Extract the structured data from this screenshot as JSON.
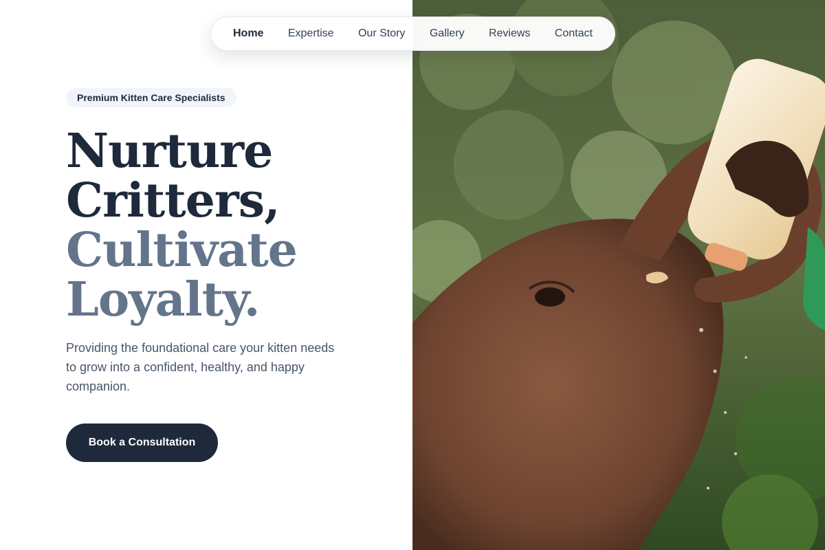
{
  "nav": {
    "items": [
      {
        "label": "Home",
        "active": true
      },
      {
        "label": "Expertise",
        "active": false
      },
      {
        "label": "Our Story",
        "active": false
      },
      {
        "label": "Gallery",
        "active": false
      },
      {
        "label": "Reviews",
        "active": false
      },
      {
        "label": "Contact",
        "active": false
      }
    ]
  },
  "hero": {
    "eyebrow": "Premium Kitten Care Specialists",
    "headline": {
      "line1": "Nurture",
      "line2": "Critters,",
      "line3": "Cultivate",
      "line4": "Loyalty."
    },
    "lead": "Providing the foundational care your kitten needs to grow into a confident, healthy, and happy companion.",
    "cta_label": "Book a Consultation"
  },
  "photo": {
    "subject": "baby-elephant-bottle-feeding-image"
  },
  "colors": {
    "primary": "#1e293b",
    "muted_heading": "#64748b",
    "body_text": "#475569",
    "pill_bg": "#f1f5f9",
    "white": "#ffffff"
  }
}
